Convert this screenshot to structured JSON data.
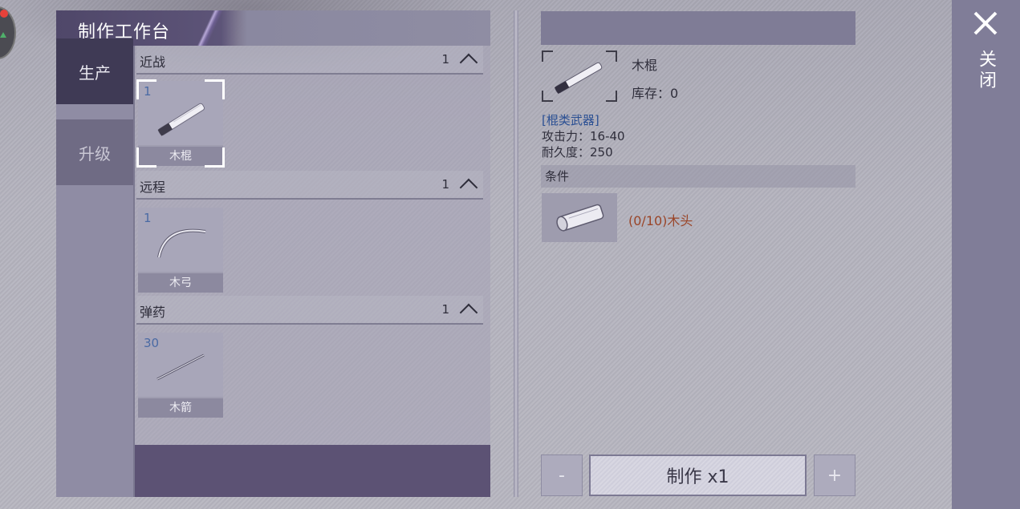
{
  "window": {
    "title": "制作工作台"
  },
  "tabs": [
    {
      "label": "生产",
      "active": true
    },
    {
      "label": "升级",
      "active": false
    }
  ],
  "categories": [
    {
      "name": "近战",
      "count": "1",
      "items": [
        {
          "qty": "1",
          "name": "木棍",
          "selected": true
        }
      ]
    },
    {
      "name": "远程",
      "count": "1",
      "items": [
        {
          "qty": "1",
          "name": "木弓",
          "selected": false
        }
      ]
    },
    {
      "name": "弹药",
      "count": "1",
      "items": [
        {
          "qty": "30",
          "name": "木箭",
          "selected": false
        }
      ]
    }
  ],
  "detail": {
    "name": "木棍",
    "stock": "库存：0",
    "type": "[棍类武器]",
    "attack": "攻击力：16-40",
    "durability": "耐久度：250",
    "conditions_title": "条件",
    "material_text": "(0/10)木头"
  },
  "actions": {
    "minus_label": "-",
    "craft_label": "制作 x1",
    "plus_label": "+"
  },
  "close": {
    "label": "关闭",
    "icon": "close-icon"
  },
  "colors": {
    "title_bar": "#4f4769",
    "active_tab": "#3f3a55",
    "type_text": "#2a4f93",
    "material_missing": "#9a4528",
    "side_bar": "#807d98"
  }
}
